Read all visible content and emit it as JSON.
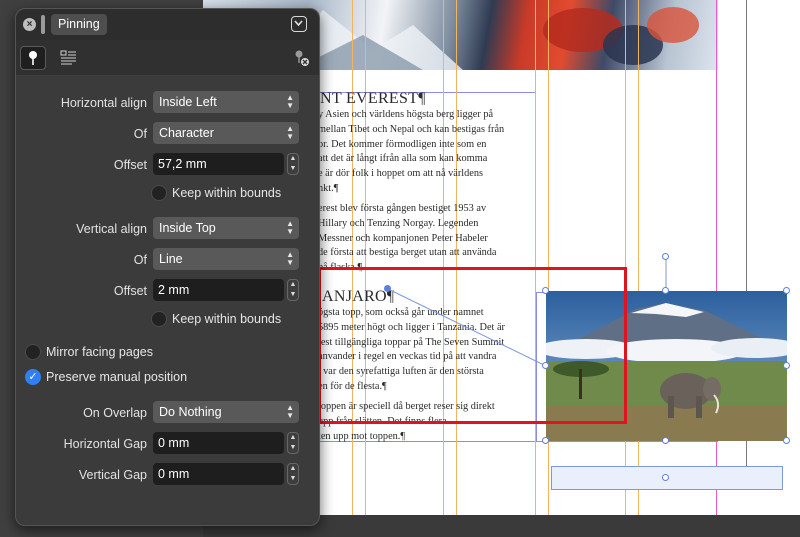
{
  "panel": {
    "title": "Pinning",
    "close_icon": "close-icon",
    "collapse_icon": "chevron-down-icon"
  },
  "fields": {
    "horizontal_align": {
      "label": "Horizontal align",
      "value": "Inside Left"
    },
    "h_of": {
      "label": "Of",
      "value": "Character"
    },
    "h_offset": {
      "label": "Offset",
      "value": "57,2 mm"
    },
    "h_keep": {
      "label": "Keep within bounds",
      "checked": false
    },
    "vertical_align": {
      "label": "Vertical align",
      "value": "Inside Top"
    },
    "v_of": {
      "label": "Of",
      "value": "Line"
    },
    "v_offset": {
      "label": "Offset",
      "value": "2 mm"
    },
    "v_keep": {
      "label": "Keep within bounds",
      "checked": false
    },
    "mirror": {
      "label": "Mirror facing pages",
      "checked": false
    },
    "preserve": {
      "label": "Preserve manual position",
      "checked": true
    },
    "on_overlap": {
      "label": "On Overlap",
      "value": "Do Nothing"
    },
    "h_gap": {
      "label": "Horizontal Gap",
      "value": "0 mm"
    },
    "v_gap": {
      "label": "Vertical Gap",
      "value": "0 mm"
    }
  },
  "document": {
    "heading1": "NT EVEREST¶",
    "para1": [
      "y Asien och världens högsta berg ligger på",
      "mellan Tibet och Nepal och kan bestigas från",
      "or. Det kommer förmodligen inte som en",
      "att det är långt ifrån alla som kan komma",
      "e är dör folk i hoppet om att nå världens",
      "nkt.¶"
    ],
    "para2": [
      "erest blev första gången bestiget 1953 av",
      "Hillary och Tenzing Norgay. Legenden",
      "Messner och kompanjonen Peter Habeler",
      "de första att bestiga berget utan att använda",
      "på flaska.¶"
    ],
    "heading2": "ANJARO¶",
    "para3": [
      "ögsta topp, som också går under namnet",
      "5895 meter högt och ligger i Tanzania. Det är",
      "lest tillgängliga toppar på The Seven Summit",
      "anvander i regel en veckas tid på att vandra",
      ", var den syrefattiga luften är den största",
      "en för de flesta.¶"
    ],
    "para4": [
      "toppen är speciell då berget reser sig direkt",
      "upp från slätten. Det finns flera",
      "ten upp mot toppen.¶"
    ]
  },
  "colors": {
    "accent_blue": "#2f7ff6",
    "highlight_red": "#e0141e",
    "guide_orange": "#f0b463",
    "margin_pink": "#e85bc8"
  }
}
